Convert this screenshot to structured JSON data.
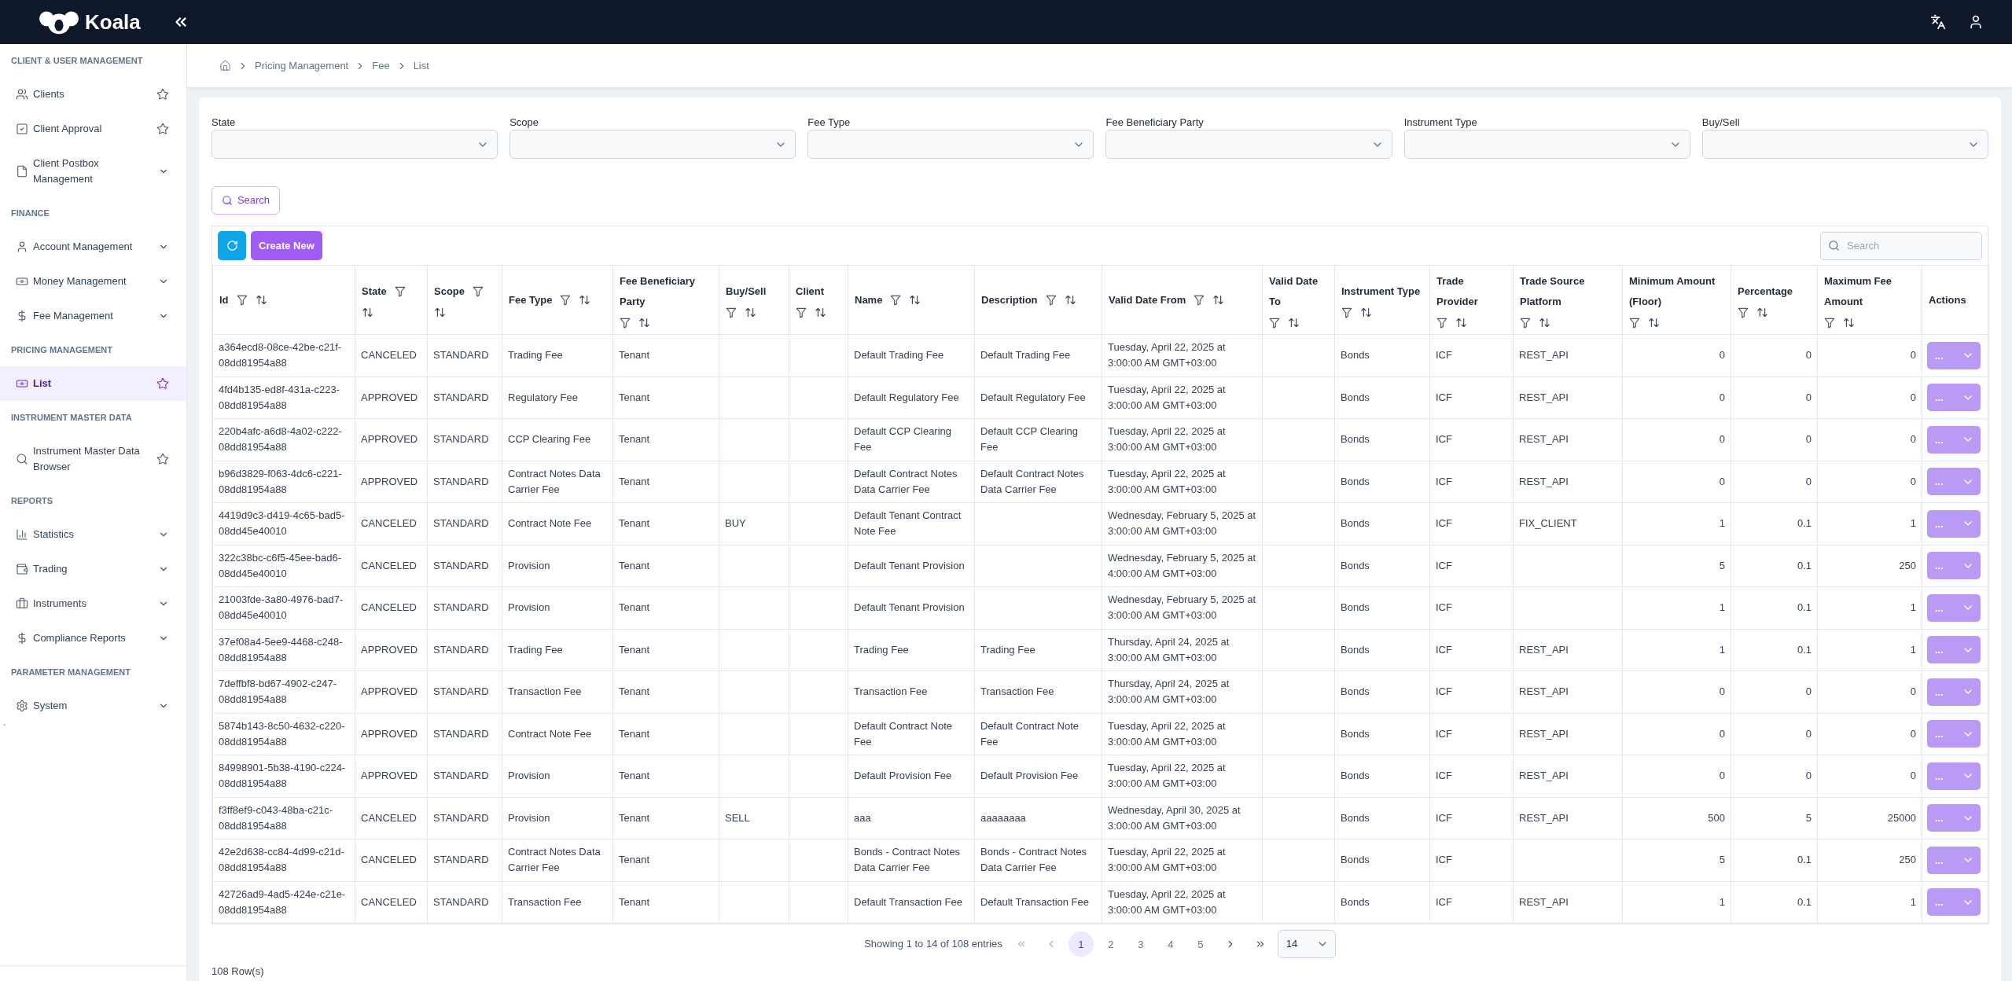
{
  "app": {
    "name": "Koala"
  },
  "sidebar": {
    "sections": [
      {
        "title": "CLIENT & USER MANAGEMENT",
        "items": [
          {
            "label": "Clients",
            "kind": "link",
            "selected": false
          },
          {
            "label": "Client Approval",
            "kind": "link",
            "selected": false
          },
          {
            "label": "Client Postbox Management",
            "kind": "group",
            "selected": false,
            "expanded": false
          }
        ]
      },
      {
        "title": "FINANCE",
        "items": [
          {
            "label": "Account Management",
            "kind": "group",
            "selected": false,
            "expanded": false
          },
          {
            "label": "Money Management",
            "kind": "group",
            "selected": false,
            "expanded": false
          },
          {
            "label": "Fee Management",
            "kind": "group",
            "selected": false,
            "expanded": false
          }
        ]
      },
      {
        "title": "PRICING MANAGEMENT",
        "items": [
          {
            "label": "List",
            "kind": "link",
            "selected": true
          }
        ]
      },
      {
        "title": "INSTRUMENT MASTER DATA",
        "items": [
          {
            "label": "Instrument Master Data Browser",
            "kind": "link",
            "selected": false
          }
        ]
      },
      {
        "title": "REPORTS",
        "items": [
          {
            "label": "Statistics",
            "kind": "group",
            "selected": false,
            "expanded": false
          },
          {
            "label": "Trading",
            "kind": "group",
            "selected": false,
            "expanded": false
          },
          {
            "label": "Instruments",
            "kind": "group",
            "selected": false,
            "expanded": false
          },
          {
            "label": "Compliance Reports",
            "kind": "group",
            "selected": false,
            "expanded": false
          }
        ]
      },
      {
        "title": "PARAMETER MANAGEMENT",
        "items": [
          {
            "label": "System",
            "kind": "group",
            "selected": false,
            "expanded": false
          }
        ]
      }
    ],
    "stray_text": "`"
  },
  "breadcrumb": [
    "Pricing Management",
    "Fee",
    "List"
  ],
  "filters": [
    {
      "label": "State"
    },
    {
      "label": "Scope"
    },
    {
      "label": "Fee Type"
    },
    {
      "label": "Fee Beneficiary Party"
    },
    {
      "label": "Instrument Type"
    },
    {
      "label": "Buy/Sell"
    }
  ],
  "search_button": {
    "label": "Search"
  },
  "toolbar": {
    "create_button": "Create New",
    "search": {
      "placeholder": "Search"
    }
  },
  "table": {
    "columns": [
      {
        "label": "Id",
        "kind": "data"
      },
      {
        "label": "State",
        "kind": "data"
      },
      {
        "label": "Scope",
        "kind": "data"
      },
      {
        "label": "Fee Type",
        "kind": "data"
      },
      {
        "label": "Fee Beneficiary Party",
        "kind": "data"
      },
      {
        "label": "Buy/Sell",
        "kind": "data"
      },
      {
        "label": "Client",
        "kind": "data"
      },
      {
        "label": "Name",
        "kind": "data"
      },
      {
        "label": "Description",
        "kind": "data"
      },
      {
        "label": "Valid Date From",
        "kind": "data"
      },
      {
        "label": "Valid Date To",
        "kind": "data"
      },
      {
        "label": "Instrument Type",
        "kind": "data"
      },
      {
        "label": "Trade Provider",
        "kind": "data"
      },
      {
        "label": "Trade Source Platform",
        "kind": "data"
      },
      {
        "label": "Minimum Amount (Floor)",
        "kind": "data"
      },
      {
        "label": "Percentage",
        "kind": "data"
      },
      {
        "label": "Maximum Fee Amount",
        "kind": "data"
      },
      {
        "label": "Actions",
        "kind": "actions"
      }
    ],
    "rows": [
      {
        "id": "a364ecd8-08ce-42be-c21f-08dd81954a88",
        "state": "CANCELED",
        "scope": "STANDARD",
        "fee_type": "Trading Fee",
        "beneficiary": "Tenant",
        "name": "Default Trading Fee",
        "description": "Default Trading Fee",
        "valid_from": "Tuesday, April 22, 2025 at 3:00:00 AM GMT+03:00",
        "instrument_type": "Bonds",
        "trade_provider": "ICF",
        "platform": "REST_API",
        "minimum_amount": "0",
        "percentage": "0",
        "maximum_fee": "0",
        "action": "..."
      },
      {
        "id": "4fd4b135-ed8f-431a-c223-08dd81954a88",
        "state": "APPROVED",
        "scope": "STANDARD",
        "fee_type": "Regulatory Fee",
        "beneficiary": "Tenant",
        "name": "Default Regulatory Fee",
        "description": "Default Regulatory Fee",
        "valid_from": "Tuesday, April 22, 2025 at 3:00:00 AM GMT+03:00",
        "instrument_type": "Bonds",
        "trade_provider": "ICF",
        "platform": "REST_API",
        "minimum_amount": "0",
        "percentage": "0",
        "maximum_fee": "0",
        "action": "..."
      },
      {
        "id": "220b4afc-a6d8-4a02-c222-08dd81954a88",
        "state": "APPROVED",
        "scope": "STANDARD",
        "fee_type": "CCP Clearing Fee",
        "beneficiary": "Tenant",
        "name": "Default CCP Clearing Fee",
        "description": "Default CCP Clearing Fee",
        "valid_from": "Tuesday, April 22, 2025 at 3:00:00 AM GMT+03:00",
        "instrument_type": "Bonds",
        "trade_provider": "ICF",
        "platform": "REST_API",
        "minimum_amount": "0",
        "percentage": "0",
        "maximum_fee": "0",
        "action": "..."
      },
      {
        "id": "b96d3829-f063-4dc6-c221-08dd81954a88",
        "state": "APPROVED",
        "scope": "STANDARD",
        "fee_type": "Contract Notes Data Carrier Fee",
        "beneficiary": "Tenant",
        "name": "Default Contract Notes Data Carrier Fee",
        "description": "Default Contract Notes Data Carrier Fee",
        "valid_from": "Tuesday, April 22, 2025 at 3:00:00 AM GMT+03:00",
        "instrument_type": "Bonds",
        "trade_provider": "ICF",
        "platform": "REST_API",
        "minimum_amount": "0",
        "percentage": "0",
        "maximum_fee": "0",
        "action": "..."
      },
      {
        "id": "4419d9c3-d419-4c65-bad5-08dd45e40010",
        "state": "CANCELED",
        "scope": "STANDARD",
        "fee_type": "Contract Note Fee",
        "beneficiary": "Tenant",
        "buy_sell": "BUY",
        "name": "Default Tenant Contract Note Fee",
        "valid_from": "Wednesday, February 5, 2025 at 3:00:00 AM GMT+03:00",
        "instrument_type": "Bonds",
        "trade_provider": "ICF",
        "platform": "FIX_CLIENT",
        "minimum_amount": "1",
        "percentage": "0.1",
        "maximum_fee": "1",
        "action": "..."
      },
      {
        "id": "322c38bc-c6f5-45ee-bad6-08dd45e40010",
        "state": "CANCELED",
        "scope": "STANDARD",
        "fee_type": "Provision",
        "beneficiary": "Tenant",
        "name": "Default Tenant Provision",
        "valid_from": "Wednesday, February 5, 2025 at 4:00:00 AM GMT+03:00",
        "instrument_type": "Bonds",
        "trade_provider": "ICF",
        "minimum_amount": "5",
        "percentage": "0.1",
        "maximum_fee": "250",
        "action": "..."
      },
      {
        "id": "21003fde-3a80-4976-bad7-08dd45e40010",
        "state": "CANCELED",
        "scope": "STANDARD",
        "fee_type": "Provision",
        "beneficiary": "Tenant",
        "name": "Default Tenant Provision",
        "valid_from": "Wednesday, February 5, 2025 at 3:00:00 AM GMT+03:00",
        "instrument_type": "Bonds",
        "trade_provider": "ICF",
        "minimum_amount": "1",
        "percentage": "0.1",
        "maximum_fee": "1",
        "action": "..."
      },
      {
        "id": "37ef08a4-5ee9-4468-c248-08dd81954a88",
        "state": "APPROVED",
        "scope": "STANDARD",
        "fee_type": "Trading Fee",
        "beneficiary": "Tenant",
        "name": "Trading Fee",
        "description": "Trading Fee",
        "valid_from": "Thursday, April 24, 2025 at 3:00:00 AM GMT+03:00",
        "instrument_type": "Bonds",
        "trade_provider": "ICF",
        "platform": "REST_API",
        "minimum_amount": "1",
        "percentage": "0.1",
        "maximum_fee": "1",
        "action": "..."
      },
      {
        "id": "7deffbf8-bd67-4902-c247-08dd81954a88",
        "state": "APPROVED",
        "scope": "STANDARD",
        "fee_type": "Transaction Fee",
        "beneficiary": "Tenant",
        "name": "Transaction Fee",
        "description": "Transaction Fee",
        "valid_from": "Thursday, April 24, 2025 at 3:00:00 AM GMT+03:00",
        "instrument_type": "Bonds",
        "trade_provider": "ICF",
        "platform": "REST_API",
        "minimum_amount": "0",
        "percentage": "0",
        "maximum_fee": "0",
        "action": "..."
      },
      {
        "id": "5874b143-8c50-4632-c220-08dd81954a88",
        "state": "APPROVED",
        "scope": "STANDARD",
        "fee_type": "Contract Note Fee",
        "beneficiary": "Tenant",
        "name": "Default Contract Note Fee",
        "description": "Default Contract Note Fee",
        "valid_from": "Tuesday, April 22, 2025 at 3:00:00 AM GMT+03:00",
        "instrument_type": "Bonds",
        "trade_provider": "ICF",
        "platform": "REST_API",
        "minimum_amount": "0",
        "percentage": "0",
        "maximum_fee": "0",
        "action": "..."
      },
      {
        "id": "84998901-5b38-4190-c224-08dd81954a88",
        "state": "APPROVED",
        "scope": "STANDARD",
        "fee_type": "Provision",
        "beneficiary": "Tenant",
        "name": "Default Provision Fee",
        "description": "Default Provision Fee",
        "valid_from": "Tuesday, April 22, 2025 at 3:00:00 AM GMT+03:00",
        "instrument_type": "Bonds",
        "trade_provider": "ICF",
        "platform": "REST_API",
        "minimum_amount": "0",
        "percentage": "0",
        "maximum_fee": "0",
        "action": "..."
      },
      {
        "id": "f3ff8ef9-c043-48ba-c21c-08dd81954a88",
        "state": "CANCELED",
        "scope": "STANDARD",
        "fee_type": "Provision",
        "beneficiary": "Tenant",
        "buy_sell": "SELL",
        "name": "aaa",
        "description": "aaaaaaaa",
        "valid_from": "Wednesday, April 30, 2025 at 3:00:00 AM GMT+03:00",
        "instrument_type": "Bonds",
        "trade_provider": "ICF",
        "platform": "REST_API",
        "minimum_amount": "500",
        "percentage": "5",
        "maximum_fee": "25000",
        "action": "..."
      },
      {
        "id": "42e2d638-cc84-4d99-c21d-08dd81954a88",
        "state": "CANCELED",
        "scope": "STANDARD",
        "fee_type": "Contract Notes Data Carrier Fee",
        "beneficiary": "Tenant",
        "name": "Bonds - Contract Notes Data Carrier Fee",
        "description": "Bonds - Contract Notes Data Carrier Fee",
        "valid_from": "Tuesday, April 22, 2025 at 3:00:00 AM GMT+03:00",
        "instrument_type": "Bonds",
        "trade_provider": "ICF",
        "minimum_amount": "5",
        "percentage": "0.1",
        "maximum_fee": "250",
        "action": "..."
      },
      {
        "id": "42726ad9-4ad5-424e-c21e-08dd81954a88",
        "state": "CANCELED",
        "scope": "STANDARD",
        "fee_type": "Transaction Fee",
        "beneficiary": "Tenant",
        "name": "Default Transaction Fee",
        "description": "Default Transaction Fee",
        "valid_from": "Tuesday, April 22, 2025 at 3:00:00 AM GMT+03:00",
        "instrument_type": "Bonds",
        "trade_provider": "ICF",
        "platform": "REST_API",
        "minimum_amount": "1",
        "percentage": "0.1",
        "maximum_fee": "1",
        "action": "..."
      }
    ]
  },
  "pagination": {
    "summary": "Showing 1 to 14 of 108 entries",
    "prev_disabled": true,
    "next_disabled": false,
    "pages": [
      {
        "label": "1",
        "selected": true
      },
      {
        "label": "2",
        "selected": false
      },
      {
        "label": "3",
        "selected": false
      },
      {
        "label": "4",
        "selected": false
      },
      {
        "label": "5",
        "selected": false
      }
    ],
    "page_size": "14"
  },
  "row_count": "108 Row(s)"
}
